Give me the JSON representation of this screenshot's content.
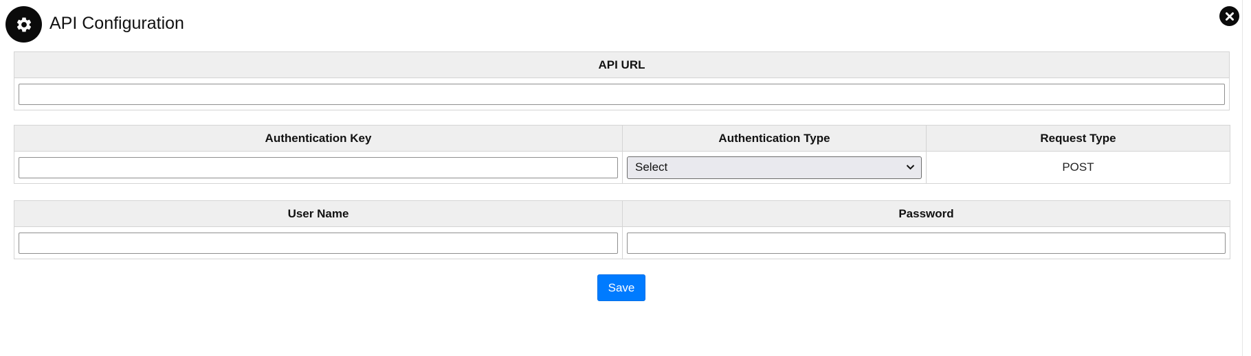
{
  "header": {
    "title": "API Configuration",
    "icon": "gear-icon",
    "close_icon": "close-icon"
  },
  "api_url_section": {
    "header": "API URL",
    "value": ""
  },
  "auth_section": {
    "headers": [
      "Authentication Key",
      "Authentication Type",
      "Request Type"
    ],
    "auth_key_value": "",
    "auth_type_selected": "Select",
    "request_type_value": "POST"
  },
  "credentials_section": {
    "headers": [
      "User Name",
      "Password"
    ],
    "username_value": "",
    "password_value": ""
  },
  "actions": {
    "save_label": "Save"
  },
  "colors": {
    "primary": "#007bff",
    "header_bg": "#efefef",
    "icon_bg": "#0b0b0b"
  }
}
